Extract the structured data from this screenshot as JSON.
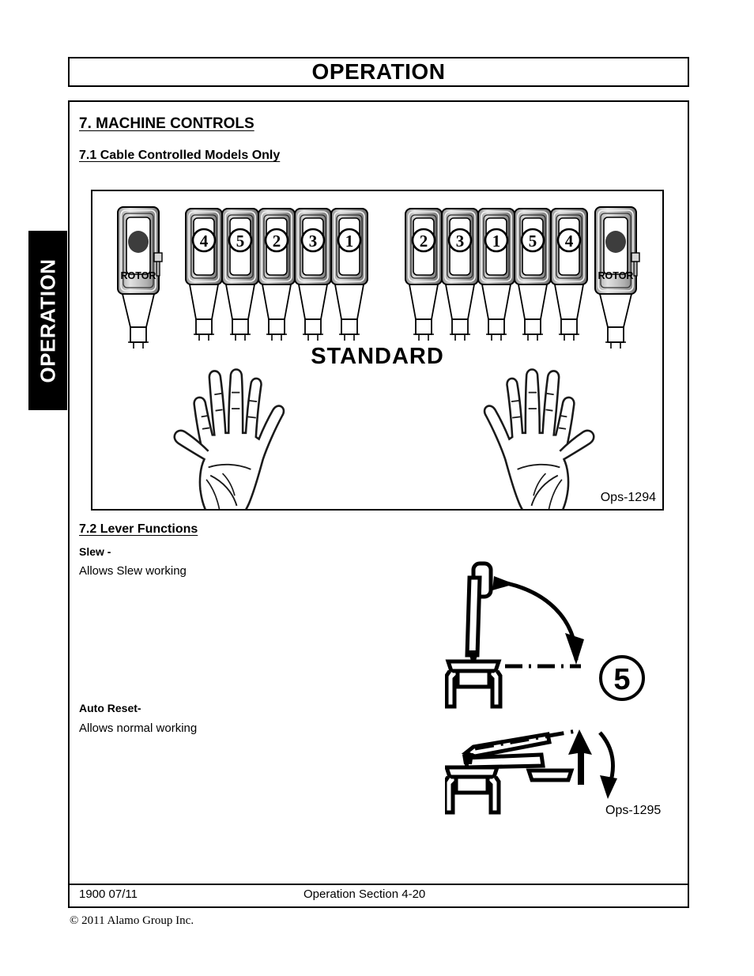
{
  "page": {
    "header_title": "OPERATION",
    "side_tab_label": "OPERATION"
  },
  "sections": {
    "machine_controls_heading": "7. MACHINE CONTROLS",
    "cable_controlled_heading": "7.1 Cable Controlled Models Only",
    "lever_functions_heading": "7.2 Lever Functions"
  },
  "lever_functions": {
    "slew_label": "Slew -",
    "slew_text": "Allows Slew working",
    "auto_reset_label": "Auto Reset-",
    "auto_reset_text": "Allows normal working",
    "slew_lever_number": "5"
  },
  "control_panel": {
    "center_word": "STANDARD",
    "caption": "Ops-1294",
    "left_rotor_label": "ROTOR",
    "right_rotor_label": "ROTOR",
    "left_group_numbers": [
      "4",
      "5",
      "2",
      "3",
      "1"
    ],
    "right_group_numbers": [
      "2",
      "3",
      "1",
      "5",
      "4"
    ]
  },
  "lever_figure": {
    "caption": "Ops-1295"
  },
  "footer": {
    "left": "1900   07/11",
    "center": "Operation Section 4-20",
    "copyright": "© 2011 Alamo Group Inc."
  }
}
